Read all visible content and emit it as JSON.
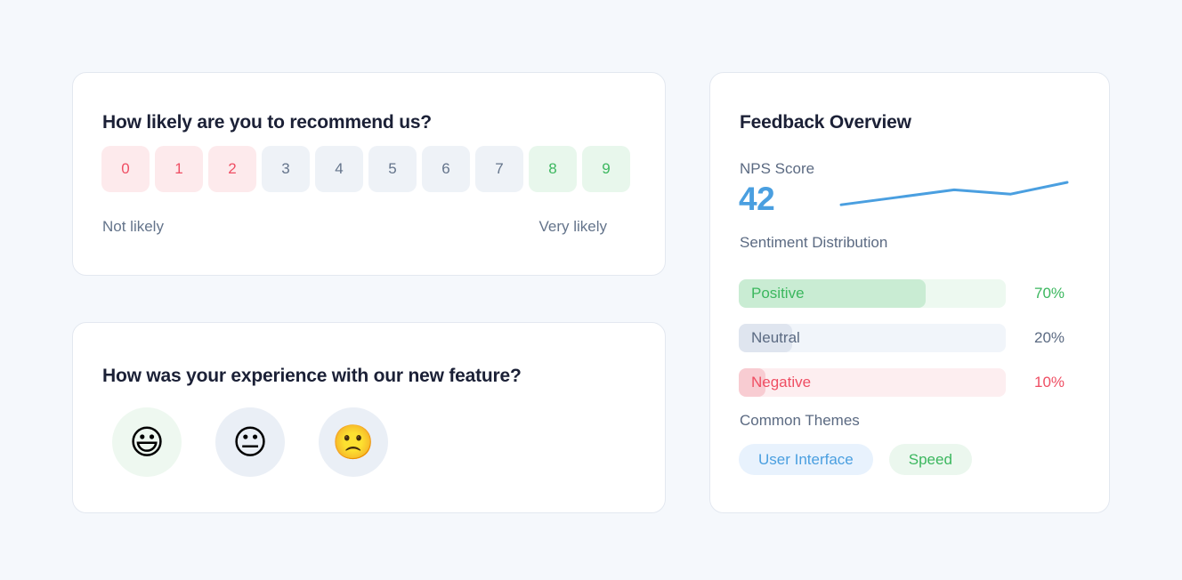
{
  "nps_card": {
    "title": "How likely are you to recommend us?",
    "options": [
      {
        "label": "0",
        "tone": "detractor"
      },
      {
        "label": "1",
        "tone": "detractor"
      },
      {
        "label": "2",
        "tone": "detractor"
      },
      {
        "label": "3",
        "tone": "passive"
      },
      {
        "label": "4",
        "tone": "passive"
      },
      {
        "label": "5",
        "tone": "passive"
      },
      {
        "label": "6",
        "tone": "passive"
      },
      {
        "label": "7",
        "tone": "passive"
      },
      {
        "label": "8",
        "tone": "promoter"
      },
      {
        "label": "9",
        "tone": "promoter"
      }
    ],
    "low_label": "Not likely",
    "high_label": "Very likely"
  },
  "emoji_card": {
    "title": "How was your experience with our new feature?",
    "options": [
      {
        "glyph": "😃",
        "name": "grinning-face-emoji",
        "tone": "tint-green"
      },
      {
        "glyph": "😐",
        "name": "neutral-face-emoji",
        "tone": "tint-slate"
      },
      {
        "glyph": "🙁",
        "name": "frowning-face-emoji",
        "tone": "tint-slate"
      }
    ]
  },
  "overview_card": {
    "title": "Feedback Overview",
    "nps_score_label": "NPS Score",
    "nps_score_value": "42",
    "sentiment_label": "Sentiment Distribution",
    "sentiment": [
      {
        "label": "Positive",
        "percent": "70%",
        "value": 70,
        "tone": "s-positive",
        "color": "#3bb75e"
      },
      {
        "label": "Neutral",
        "percent": "20%",
        "value": 20,
        "tone": "s-neutral",
        "color": "#5b6a82"
      },
      {
        "label": "Negative",
        "percent": "10%",
        "value": 10,
        "tone": "s-negative",
        "color": "#ef4e63"
      }
    ],
    "themes_label": "Common Themes",
    "themes": [
      {
        "label": "User Interface",
        "tone": "blue"
      },
      {
        "label": "Speed",
        "tone": "green"
      }
    ]
  },
  "chart_data": {
    "type": "line",
    "title": "NPS Score trend",
    "series": [
      {
        "name": "NPS",
        "x": [
          0,
          1,
          2,
          3,
          4
        ],
        "values": [
          18,
          32,
          46,
          38,
          60
        ]
      }
    ],
    "line_color": "#4a9fe0",
    "grid": false,
    "legend": "none",
    "xlabel": "",
    "ylabel": "",
    "ylim": [
      0,
      70
    ]
  },
  "colors": {
    "page_background": "#f5f8fc",
    "card_background": "#ffffff",
    "card_border": "#e3e8f0",
    "title": "#1b2036",
    "muted_text": "#5b6a82",
    "accent_blue": "#4a9fe0",
    "positive_green": "#3bb75e",
    "negative_red": "#ef4e63"
  }
}
